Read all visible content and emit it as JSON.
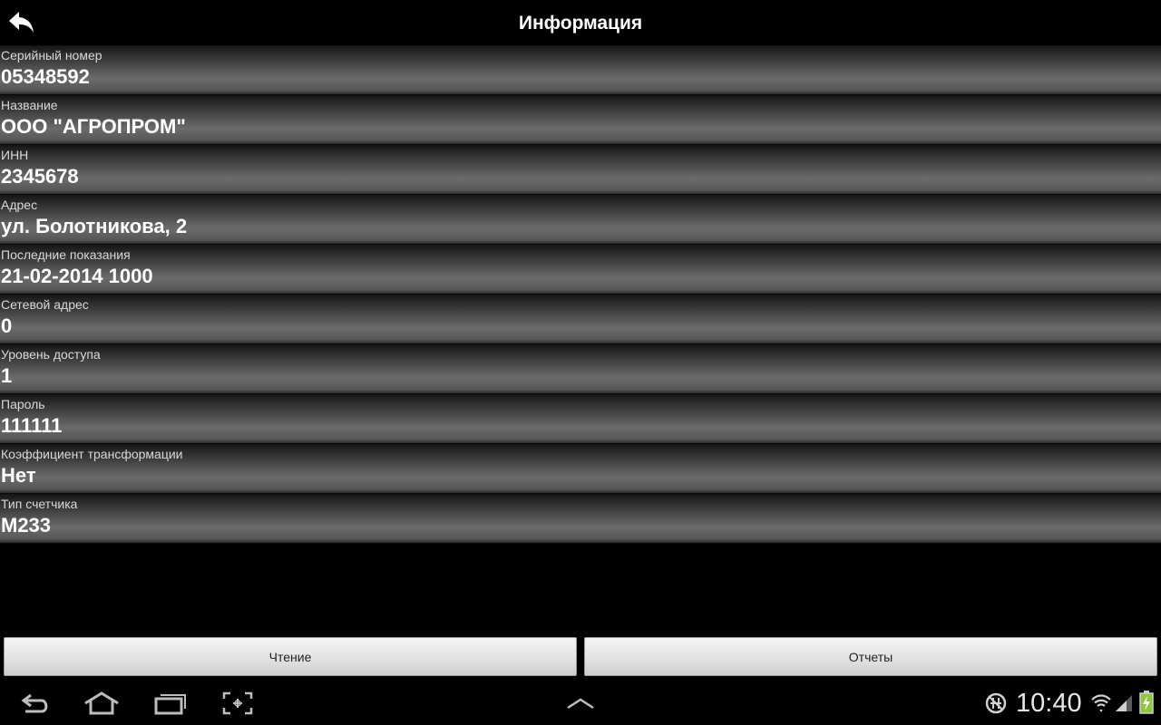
{
  "header": {
    "title": "Информация"
  },
  "info": [
    {
      "label": "Серийный номер",
      "value": "05348592"
    },
    {
      "label": "Название",
      "value": "ООО \"АГРОПРОМ\""
    },
    {
      "label": "ИНН",
      "value": "2345678"
    },
    {
      "label": "Адрес",
      "value": "ул. Болотникова, 2"
    },
    {
      "label": "Последние показания",
      "value": "21-02-2014 1000"
    },
    {
      "label": "Сетевой адрес",
      "value": "0"
    },
    {
      "label": "Уровень доступа",
      "value": "1"
    },
    {
      "label": "Пароль",
      "value": "111111"
    },
    {
      "label": "Коэффициент трансформации",
      "value": "Нет"
    },
    {
      "label": "Тип счетчика",
      "value": "М233"
    }
  ],
  "buttons": {
    "read_label": "Чтение",
    "reports_label": "Отчеты"
  },
  "status_bar": {
    "time": "10:40"
  },
  "icons": {
    "back": "back-arrow-icon",
    "nav_back": "nav-back-icon",
    "nav_home": "home-icon",
    "nav_recent": "recent-apps-icon",
    "nav_screenshot": "screenshot-icon",
    "nav_menu": "chevron-up-icon",
    "usb_debug": "usb-debug-icon",
    "wifi": "wifi-icon",
    "signal": "signal-icon",
    "battery": "battery-charging-icon"
  },
  "colors": {
    "background": "#000000",
    "row_gradient_mid": "#6b6b6b",
    "button_face": "#e2e2e2",
    "battery_green": "#8ec63f"
  }
}
